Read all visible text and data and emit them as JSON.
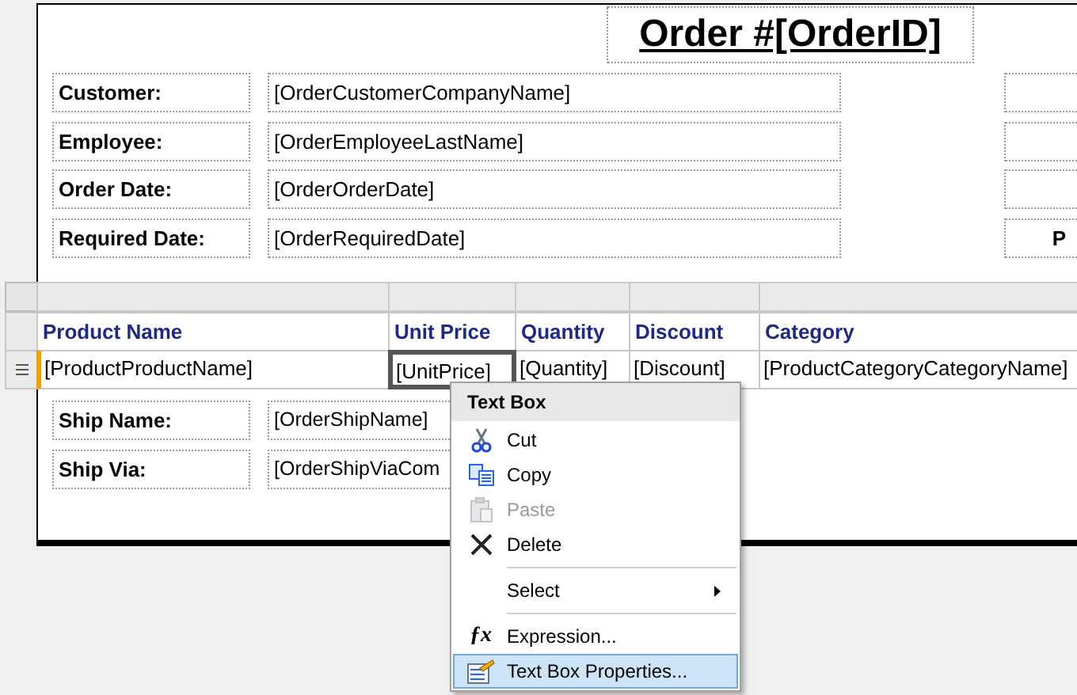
{
  "report": {
    "title": "Order #[OrderID]",
    "header_fields": [
      {
        "label": "Customer:",
        "value": "[OrderCustomerCompanyName]"
      },
      {
        "label": "Employee:",
        "value": "[OrderEmployeeLastName]"
      },
      {
        "label": "Order Date:",
        "value": "[OrderOrderDate]"
      },
      {
        "label": "Required Date:",
        "value": "[OrderRequiredDate]",
        "right": "P"
      }
    ],
    "table": {
      "columns": [
        "Product Name",
        "Unit Price",
        "Quantity",
        "Discount",
        "Category"
      ],
      "row": [
        {
          "text": "[ProductProductName]",
          "selected": false
        },
        {
          "text": "[UnitPrice]",
          "selected": true
        },
        {
          "text": "[Quantity]",
          "selected": false
        },
        {
          "text": "[Discount]",
          "selected": false
        },
        {
          "text": "[ProductCategoryCategoryName]",
          "selected": false
        }
      ]
    },
    "footer_fields": [
      {
        "label": "Ship Name:",
        "value": "[OrderShipName]"
      },
      {
        "label": "Ship Via:",
        "value": "[OrderShipViaCom"
      }
    ]
  },
  "context_menu": {
    "title": "Text Box",
    "items": [
      {
        "kind": "item",
        "label": "Cut",
        "disabled": false,
        "selected": false,
        "submenu": false
      },
      {
        "kind": "item",
        "label": "Copy",
        "disabled": false,
        "selected": false,
        "submenu": false
      },
      {
        "kind": "item",
        "label": "Paste",
        "disabled": true,
        "selected": false,
        "submenu": false
      },
      {
        "kind": "item",
        "label": "Delete",
        "disabled": false,
        "selected": false,
        "submenu": false
      },
      {
        "kind": "separator"
      },
      {
        "kind": "item",
        "label": "Select",
        "disabled": false,
        "selected": false,
        "submenu": true
      },
      {
        "kind": "separator"
      },
      {
        "kind": "item",
        "label": "Expression...",
        "disabled": false,
        "selected": false,
        "submenu": false,
        "glyph": "ƒx"
      },
      {
        "kind": "item",
        "label": "Text Box Properties...",
        "disabled": false,
        "selected": true,
        "submenu": false
      }
    ]
  }
}
